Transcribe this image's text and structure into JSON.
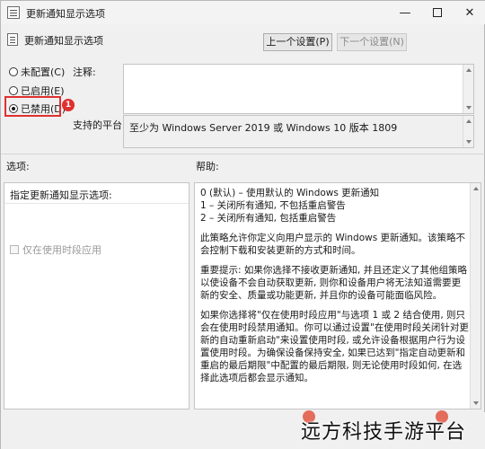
{
  "window": {
    "title": "更新通知显示选项"
  },
  "header": {
    "setting_title": "更新通知显示选项",
    "prev_label": "上一个设置(P)",
    "next_label": "下一个设置(N)"
  },
  "state": {
    "options": [
      {
        "label": "未配置(C)",
        "checked": false
      },
      {
        "label": "已启用(E)",
        "checked": false
      },
      {
        "label": "已禁用(D)",
        "checked": true
      }
    ],
    "badge": "1"
  },
  "fields": {
    "comment_label": "注释:",
    "platform_label": "支持的平台:",
    "platform_value": "至少为 Windows Server 2019 或 Windows 10 版本 1809"
  },
  "panels": {
    "options_label": "选项:",
    "help_label": "帮助:",
    "options_title": "指定更新通知显示选项:",
    "checkbox_label": "仅在使用时段应用",
    "help_paragraphs": [
      "0 (默认) – 使用默认的 Windows 更新通知",
      "1 – 关闭所有通知, 不包括重启警告",
      "2 – 关闭所有通知, 包括重启警告",
      "此策略允许你定义向用户显示的 Windows 更新通知。该策略不会控制下载和安装更新的方式和时间。",
      "重要提示: 如果你选择不接收更新通知, 并且还定义了其他组策略以使设备不会自动获取更新, 则你和设备用户将无法知道需要更新的安全、质量或功能更新, 并且你的设备可能面临风险。",
      "如果你选择将\"仅在使用时段应用\"与选项 1 或 2 结合使用, 则只会在使用时段禁用通知。你可以通过设置\"在使用时段关闭针对更新的自动重新启动\"来设置使用时段, 或允许设备根据用户行为设置使用时段。为确保设备保持安全, 如果已达到\"指定自动更新和重启的最后期限\"中配置的最后期限, 则无论使用时段如何, 在选择此选项后都会显示通知。"
    ]
  },
  "watermark": "远方科技手游平台"
}
